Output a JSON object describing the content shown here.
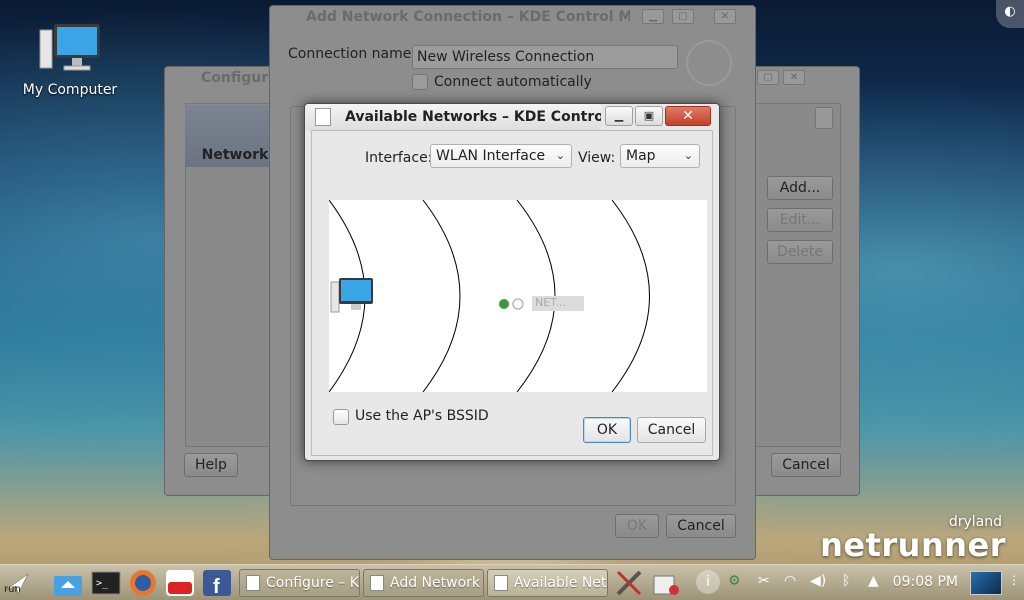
{
  "desktop": {
    "icon_label": "My Computer",
    "brand_sub": "dryland",
    "brand_main": "netrunner"
  },
  "configure_window": {
    "title": "Configure",
    "tab_label": "Network",
    "buttons": {
      "add": "Add...",
      "edit": "Edit...",
      "delete": "Delete",
      "help": "Help",
      "cancel": "Cancel"
    }
  },
  "add_network_window": {
    "title": "Add Network Connection – KDE Control Module",
    "connection_name_label": "Connection name:",
    "connection_name_value": "New Wireless Connection",
    "connect_auto_label": "Connect automatically",
    "ok_label": "OK",
    "cancel_label": "Cancel"
  },
  "dialog": {
    "title": "Available Networks – KDE Control Module",
    "interface_label": "Interface:",
    "interface_value": "WLAN Interface",
    "view_label": "View:",
    "view_value": "Map",
    "network_label": "NET...",
    "bssid_label": "Use the AP's BSSID",
    "ok_label": "OK",
    "cancel_label": "Cancel"
  },
  "taskbar": {
    "launcher_label": "run",
    "tasks": [
      {
        "label": "Configure – K"
      },
      {
        "label": "Add Network"
      },
      {
        "label": "Available Net"
      }
    ],
    "clock": "09:08 PM"
  }
}
